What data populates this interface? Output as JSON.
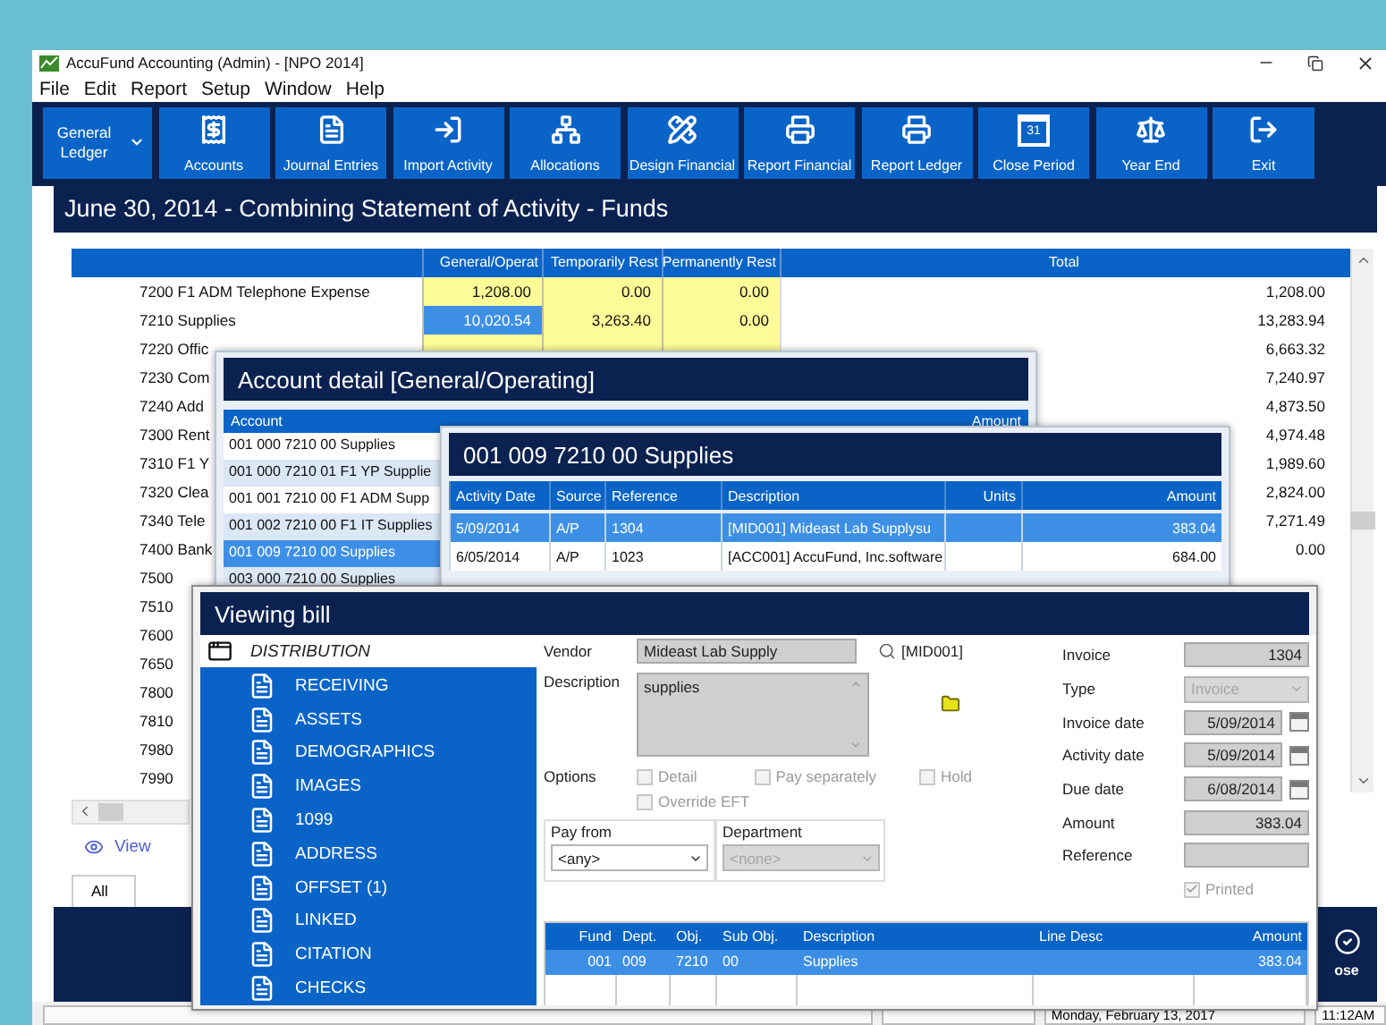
{
  "window": {
    "title": "AccuFund Accounting (Admin) - [NPO 2014]"
  },
  "menu": [
    "File",
    "Edit",
    "Report",
    "Setup",
    "Window",
    "Help"
  ],
  "toolbar": [
    {
      "label": "General Ledger",
      "kind": "dropdown"
    },
    {
      "label": "Accounts",
      "kind": "accounts"
    },
    {
      "label": "Journal Entries",
      "kind": "journal"
    },
    {
      "label": "Import Activity",
      "kind": "import"
    },
    {
      "label": "Allocations",
      "kind": "allocations"
    },
    {
      "label": "Design Financial",
      "kind": "design"
    },
    {
      "label": "Report Financial",
      "kind": "print"
    },
    {
      "label": "Report Ledger",
      "kind": "print"
    },
    {
      "label": "Close Period",
      "kind": "calendar",
      "icon_text": "31"
    },
    {
      "label": "Year End",
      "kind": "scale"
    },
    {
      "label": "Exit",
      "kind": "exit"
    }
  ],
  "report": {
    "title": "June 30, 2014 - Combining Statement of Activity - Funds",
    "columns": [
      "General/Operat",
      "Temporarily Rest",
      "Permanently Rest",
      "Total"
    ],
    "rows": [
      {
        "account": "7200 F1 ADM Telephone Expense",
        "highlighted": true,
        "cells": [
          {
            "value": "1,208.00",
            "selected": false
          },
          {
            "value": "0.00",
            "selected": false
          },
          {
            "value": "0.00",
            "selected": false
          }
        ],
        "total": "1,208.00"
      },
      {
        "account": "7210 Supplies",
        "highlighted": true,
        "cells": [
          {
            "value": "10,020.54",
            "selected": true
          },
          {
            "value": "3,263.40",
            "selected": false
          },
          {
            "value": "0.00",
            "selected": false
          }
        ],
        "total": "13,283.94"
      },
      {
        "account": "7220 Offic",
        "highlighted": true,
        "total": "6,663.32"
      },
      {
        "account": "7230 Com",
        "highlighted": false,
        "total": "7,240.97"
      },
      {
        "account": "7240 Add",
        "highlighted": false,
        "total": "4,873.50"
      },
      {
        "account": "7300 Rent",
        "highlighted": false,
        "total": "4,974.48"
      },
      {
        "account": "7310 F1 Y",
        "highlighted": false,
        "total": "1,989.60"
      },
      {
        "account": "7320 Clea",
        "highlighted": false,
        "total": "2,824.00"
      },
      {
        "account": "7340 Tele",
        "highlighted": false,
        "total": "7,271.49"
      },
      {
        "account": "7400 Bank",
        "highlighted": false,
        "total": "0.00"
      },
      {
        "account": "7500",
        "highlighted": false
      },
      {
        "account": "7510",
        "highlighted": false
      },
      {
        "account": "7600",
        "highlighted": false
      },
      {
        "account": "7650",
        "highlighted": false
      },
      {
        "account": "7800",
        "highlighted": false
      },
      {
        "account": "7810",
        "highlighted": false
      },
      {
        "account": "7980",
        "highlighted": false
      },
      {
        "account": "7990",
        "highlighted": false
      }
    ]
  },
  "view_link": "View",
  "tabs": [
    {
      "label": "All",
      "selected": true
    }
  ],
  "close_button": "ose",
  "status_bar": [
    "Monday, February 13, 2017",
    "11:12AM"
  ],
  "account_detail": {
    "title": "Account detail [General/Operating]",
    "columns": [
      "Account",
      "Amount"
    ],
    "rows": [
      {
        "account": "001 000 7210 00 Supplies",
        "selected": false
      },
      {
        "account": "001 000 7210 01 F1 YP Supplie",
        "selected": false
      },
      {
        "account": "001 001 7210 00 F1 ADM Supp",
        "selected": false
      },
      {
        "account": "001 002 7210 00 F1 IT Supplies",
        "selected": false
      },
      {
        "account": "001 009 7210 00 Supplies",
        "selected": true
      },
      {
        "account": "003 000 7210 00 Supplies",
        "selected": false
      }
    ]
  },
  "ledger_window": {
    "title": "001 009 7210 00 Supplies",
    "columns": [
      "Activity Date",
      "Source",
      "Reference",
      "Description",
      "Units",
      "Amount"
    ],
    "rows": [
      {
        "date": "5/09/2014",
        "source": "A/P",
        "reference": "1304",
        "description": "[MID001] Mideast Lab Supplysu",
        "amount": "383.04",
        "selected": true
      },
      {
        "date": "6/05/2014",
        "source": "A/P",
        "reference": "1023",
        "description": "[ACC001] AccuFund, Inc.software",
        "amount": "684.00",
        "selected": false
      }
    ]
  },
  "viewing_bill": {
    "title": "Viewing bill",
    "section_header": "DISTRIBUTION",
    "sections": [
      "RECEIVING",
      "ASSETS",
      "DEMOGRAPHICS",
      "IMAGES",
      "1099",
      "ADDRESS",
      "OFFSET (1)",
      "LINKED",
      "CITATION",
      "CHECKS"
    ],
    "vendor": {
      "label": "Vendor",
      "value": "Mideast Lab Supply",
      "code": "[MID001]"
    },
    "description": {
      "label": "Description",
      "value": "supplies"
    },
    "options": {
      "label": "Options",
      "checkboxes": [
        {
          "label": "Detail",
          "checked": false,
          "disabled": true
        },
        {
          "label": "Pay separately",
          "checked": false,
          "disabled": true
        },
        {
          "label": "Hold",
          "checked": false,
          "disabled": true
        },
        {
          "label": "Override EFT",
          "checked": false,
          "disabled": true
        }
      ]
    },
    "pay_from": {
      "label": "Pay from",
      "value": "<any>",
      "disabled": false
    },
    "department": {
      "label": "Department",
      "value": "<none>",
      "disabled": true
    },
    "fields": [
      {
        "label": "Invoice",
        "value": "1304",
        "kind": "text"
      },
      {
        "label": "Type",
        "value": "Invoice",
        "kind": "select",
        "disabled": true
      },
      {
        "label": "Invoice date",
        "value": "5/09/2014",
        "kind": "date"
      },
      {
        "label": "Activity date",
        "value": "5/09/2014",
        "kind": "date"
      },
      {
        "label": "Due date",
        "value": "6/08/2014",
        "kind": "date"
      },
      {
        "label": "Amount",
        "value": "383.04",
        "kind": "text"
      },
      {
        "label": "Reference",
        "kind": "text"
      }
    ],
    "printed": {
      "label": "Printed",
      "checked": true,
      "disabled": true
    },
    "distribution": {
      "columns": [
        "Fund",
        "Dept.",
        "Obj.",
        "Sub Obj.",
        "Description",
        "Line Desc",
        "Amount"
      ],
      "rows": [
        {
          "fund": "001",
          "dept": "009",
          "obj": "7210",
          "sub_obj": "00",
          "description": "Supplies",
          "amount": "383.04",
          "selected": true
        }
      ]
    }
  }
}
